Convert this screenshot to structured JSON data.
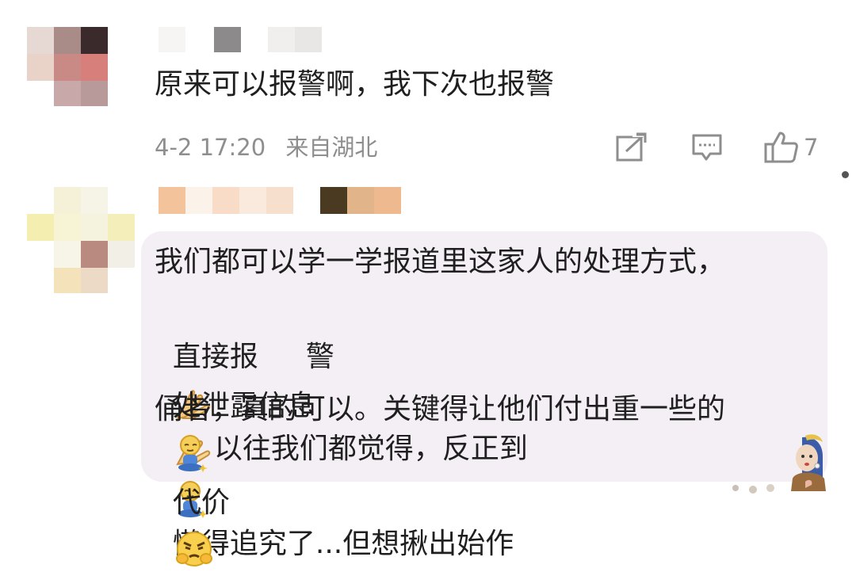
{
  "comment1": {
    "author_name": "",
    "text": "原来可以报警啊，我下次也报警",
    "date": "4-2 17:20",
    "location": "来自湖北",
    "like_count": "7",
    "icons": [
      "forward-icon",
      "comment-icon",
      "thumbs-up-icon"
    ]
  },
  "comment2": {
    "author_name": "",
    "line1": "我们都可以学一学报道里这家人的处理方式，",
    "line2_a": "直接报",
    "line2_b": "警",
    "line2_c": "以往我们都觉得，反正到",
    "line3_a": "处泄露信息",
    "line3_b": "懒得追究了...但想揪出始作",
    "line4": "俑者，真的可以。关键得让他们付出重一些的",
    "line5": "代价",
    "emojis": [
      "folded-hands-emoji",
      "folded-hands-emoji",
      "meditating-emoji",
      "meditating-emoji",
      "angry-face-emoji"
    ],
    "decoration": "girl-with-pearl-earring-sticker"
  },
  "colors": {
    "text": "#1f1f1f",
    "meta": "#8e8e8e",
    "bubble": "#f3eff4"
  }
}
